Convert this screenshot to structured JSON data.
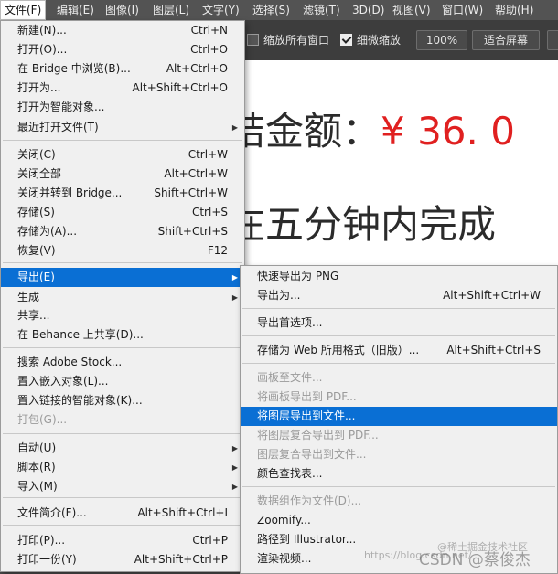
{
  "menubar": {
    "items": [
      "文件(F)",
      "编辑(E)",
      "图像(I)",
      "图层(L)",
      "文字(Y)",
      "选择(S)",
      "滤镜(T)",
      "3D(D)",
      "视图(V)",
      "窗口(W)",
      "帮助(H)"
    ]
  },
  "options": {
    "scroll_all": "缩放所有窗口",
    "scroll_all_checked": false,
    "scrubby": "细微缩放",
    "scrubby_checked": true,
    "zoom": "100%",
    "fit": "适合屏幕"
  },
  "canvas": {
    "line1_text": "结金额：",
    "line1_amount": "¥ 36. 0",
    "line2_text": "在五分钟内完成"
  },
  "file_menu": {
    "items": [
      {
        "label": "新建(N)...",
        "shortcut": "Ctrl+N"
      },
      {
        "label": "打开(O)...",
        "shortcut": "Ctrl+O"
      },
      {
        "label": "在 Bridge 中浏览(B)...",
        "shortcut": "Alt+Ctrl+O"
      },
      {
        "label": "打开为...",
        "shortcut": "Alt+Shift+Ctrl+O"
      },
      {
        "label": "打开为智能对象...",
        "shortcut": ""
      },
      {
        "label": "最近打开文件(T)",
        "shortcut": "",
        "submenu": true
      },
      {
        "label": "关闭(C)",
        "shortcut": "Ctrl+W"
      },
      {
        "label": "关闭全部",
        "shortcut": "Alt+Ctrl+W"
      },
      {
        "label": "关闭并转到 Bridge...",
        "shortcut": "Shift+Ctrl+W"
      },
      {
        "label": "存储(S)",
        "shortcut": "Ctrl+S"
      },
      {
        "label": "存储为(A)...",
        "shortcut": "Shift+Ctrl+S"
      },
      {
        "label": "恢复(V)",
        "shortcut": "F12"
      },
      {
        "label": "导出(E)",
        "shortcut": "",
        "submenu": true,
        "highlighted": true
      },
      {
        "label": "生成",
        "shortcut": "",
        "submenu": true
      },
      {
        "label": "共享...",
        "shortcut": ""
      },
      {
        "label": "在 Behance 上共享(D)...",
        "shortcut": ""
      },
      {
        "label": "搜索 Adobe Stock...",
        "shortcut": ""
      },
      {
        "label": "置入嵌入对象(L)...",
        "shortcut": ""
      },
      {
        "label": "置入链接的智能对象(K)...",
        "shortcut": ""
      },
      {
        "label": "打包(G)...",
        "shortcut": "",
        "disabled": true
      },
      {
        "label": "自动(U)",
        "shortcut": "",
        "submenu": true
      },
      {
        "label": "脚本(R)",
        "shortcut": "",
        "submenu": true
      },
      {
        "label": "导入(M)",
        "shortcut": "",
        "submenu": true
      },
      {
        "label": "文件简介(F)...",
        "shortcut": "Alt+Shift+Ctrl+I"
      },
      {
        "label": "打印(P)...",
        "shortcut": "Ctrl+P"
      },
      {
        "label": "打印一份(Y)",
        "shortcut": "Alt+Shift+Ctrl+P"
      }
    ]
  },
  "export_menu": {
    "items": [
      {
        "label": "快速导出为 PNG",
        "shortcut": ""
      },
      {
        "label": "导出为...",
        "shortcut": "Alt+Shift+Ctrl+W"
      },
      {
        "label": "导出首选项...",
        "shortcut": ""
      },
      {
        "label": "存储为 Web 所用格式（旧版）...",
        "shortcut": "Alt+Shift+Ctrl+S"
      },
      {
        "label": "画板至文件...",
        "shortcut": "",
        "disabled": true
      },
      {
        "label": "将画板导出到 PDF...",
        "shortcut": "",
        "disabled": true
      },
      {
        "label": "将图层导出到文件...",
        "shortcut": "",
        "highlighted": true
      },
      {
        "label": "将图层复合导出到 PDF...",
        "shortcut": "",
        "disabled": true
      },
      {
        "label": "图层复合导出到文件...",
        "shortcut": "",
        "disabled": true
      },
      {
        "label": "颜色查找表...",
        "shortcut": ""
      },
      {
        "label": "数据组作为文件(D)...",
        "shortcut": "",
        "disabled": true
      },
      {
        "label": "Zoomify...",
        "shortcut": ""
      },
      {
        "label": "路径到 Illustrator...",
        "shortcut": ""
      },
      {
        "label": "渲染视频...",
        "shortcut": ""
      }
    ]
  },
  "watermark": {
    "url": "https://blog.csdn.net/",
    "badge": "@稀土掘金技术社区",
    "author": "CSDN @蔡俊杰"
  }
}
